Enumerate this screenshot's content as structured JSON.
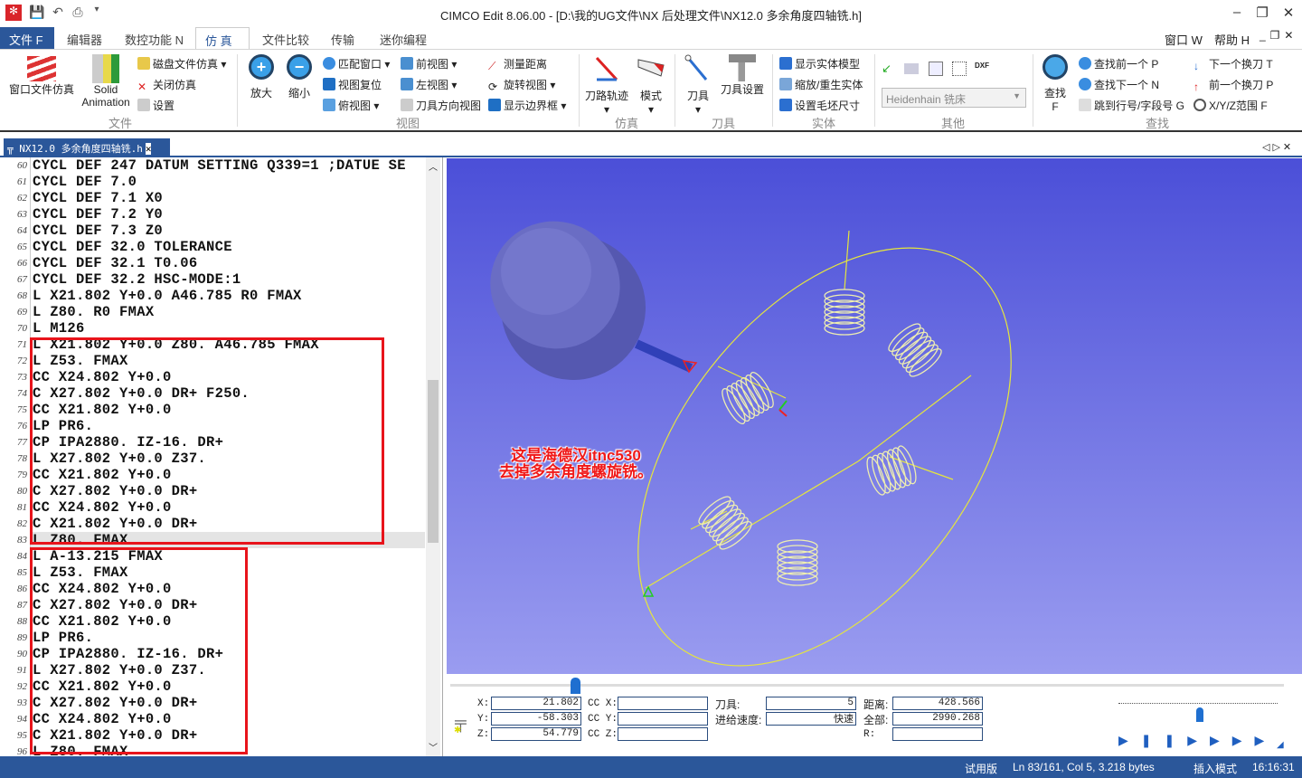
{
  "title": "CIMCO Edit 8.06.00 - [D:\\我的UG文件\\NX 后处理文件\\NX12.0 多余角度四轴铣.h]",
  "menu": {
    "tabs": [
      "文件 F",
      "编辑器",
      "数控功能 N",
      "仿 真",
      "文件比较",
      "传输",
      "迷你编程"
    ],
    "active": "仿 真",
    "right": [
      "窗口 W",
      "帮助 H"
    ]
  },
  "ribbon": {
    "file": {
      "group": "文件",
      "window_sim": "窗口文件仿真",
      "solid": "Solid",
      "animation": "Animation",
      "disk_sim": "磁盘文件仿真",
      "close_sim": "关闭仿真",
      "settings": "设置"
    },
    "view": {
      "group": "视图",
      "zoom_in": "放大",
      "zoom_out": "缩小",
      "fit": "匹配窗口",
      "reset": "视图复位",
      "top": "俯视图",
      "front": "前视图",
      "left": "左视图",
      "tool_dir": "刀具方向视图",
      "measure": "测量距离",
      "rotate": "旋转视图",
      "bbox": "显示边界框"
    },
    "sim": {
      "group": "仿真",
      "toolpath": "刀路轨迹",
      "mode": "模式"
    },
    "tool": {
      "group": "刀具",
      "tool": "刀具",
      "tool_settings": "刀具设置"
    },
    "solid": {
      "group": "实体",
      "show_solid": "显示实体模型",
      "zoom_regen": "缩放/重生实体",
      "stock": "设置毛坯尺寸"
    },
    "other": {
      "group": "其他",
      "machine": "Heidenhain 铣床",
      "dxf": "DXF"
    },
    "find": {
      "group": "查找",
      "find": "查找",
      "find_key": "F",
      "prev": "查找前一个 P",
      "next": "查找下一个 N",
      "goto": "跳到行号/字段号 G",
      "next_tool": "下一个换刀 T",
      "prev_tool": "前一个换刀 P",
      "range": "X/Y/Z范围 F"
    }
  },
  "doc_tab": "NX12.0 多余角度四轴铣.h",
  "editor": {
    "lines": [
      {
        "n": "60",
        "t": "CYCL DEF 247 DATUM SETTING Q339=1 ;DATUE SE"
      },
      {
        "n": "61",
        "t": "CYCL DEF 7.0"
      },
      {
        "n": "62",
        "t": "CYCL DEF 7.1 X0"
      },
      {
        "n": "63",
        "t": "CYCL DEF 7.2 Y0"
      },
      {
        "n": "64",
        "t": "CYCL DEF 7.3 Z0"
      },
      {
        "n": "65",
        "t": "CYCL DEF 32.0 TOLERANCE"
      },
      {
        "n": "66",
        "t": "CYCL DEF 32.1 T0.06"
      },
      {
        "n": "67",
        "t": "CYCL DEF 32.2 HSC-MODE:1"
      },
      {
        "n": "68",
        "t": "L X21.802 Y+0.0 A46.785 R0 FMAX"
      },
      {
        "n": "69",
        "t": "L Z80. R0 FMAX"
      },
      {
        "n": "70",
        "t": "L M126"
      },
      {
        "n": "71",
        "t": "L X21.802 Y+0.0 Z80. A46.785 FMAX"
      },
      {
        "n": "72",
        "t": "L Z53. FMAX"
      },
      {
        "n": "73",
        "t": "CC X24.802 Y+0.0"
      },
      {
        "n": "74",
        "t": "C X27.802 Y+0.0 DR+ F250."
      },
      {
        "n": "75",
        "t": "CC X21.802 Y+0.0"
      },
      {
        "n": "76",
        "t": "LP PR6."
      },
      {
        "n": "77",
        "t": "CP IPA2880. IZ-16. DR+"
      },
      {
        "n": "78",
        "t": "L X27.802 Y+0.0 Z37."
      },
      {
        "n": "79",
        "t": "CC X21.802 Y+0.0"
      },
      {
        "n": "80",
        "t": "C X27.802 Y+0.0 DR+"
      },
      {
        "n": "81",
        "t": "CC X24.802 Y+0.0"
      },
      {
        "n": "82",
        "t": "C X21.802 Y+0.0 DR+"
      },
      {
        "n": "83",
        "t": "L Z80. FMAX"
      },
      {
        "n": "84",
        "t": "L A-13.215 FMAX"
      },
      {
        "n": "85",
        "t": "L Z53. FMAX"
      },
      {
        "n": "86",
        "t": "CC X24.802 Y+0.0"
      },
      {
        "n": "87",
        "t": "C X27.802 Y+0.0 DR+"
      },
      {
        "n": "88",
        "t": "CC X21.802 Y+0.0"
      },
      {
        "n": "89",
        "t": "LP PR6."
      },
      {
        "n": "90",
        "t": "CP IPA2880. IZ-16. DR+"
      },
      {
        "n": "91",
        "t": "L X27.802 Y+0.0 Z37."
      },
      {
        "n": "92",
        "t": "CC X21.802 Y+0.0"
      },
      {
        "n": "93",
        "t": "C X27.802 Y+0.0 DR+"
      },
      {
        "n": "94",
        "t": "CC X24.802 Y+0.0"
      },
      {
        "n": "95",
        "t": "C X21.802 Y+0.0 DR+"
      },
      {
        "n": "96",
        "t": "L Z80. FMAX"
      }
    ],
    "current_line": "83"
  },
  "annotation": [
    "这是海德汉itnc530",
    "去掉多余角度螺旋铣。"
  ],
  "sim_panel": {
    "x_label": "X:",
    "x": "21.802",
    "y_label": "Y:",
    "y": "-58.303",
    "z_label": "Z:",
    "z": "54.779",
    "ccx_label": "CC X:",
    "ccy_label": "CC Y:",
    "ccz_label": "CC Z:",
    "tool_label": "刀具:",
    "tool": "5",
    "feed_label": "进给速度:",
    "feed": "快速",
    "dist_label": "距离:",
    "dist": "428.566",
    "total_label": "全部:",
    "total": "2990.268",
    "r_label": "R:",
    "progress": 0.15
  },
  "status": {
    "trial": "试用版",
    "position": "Ln 83/161, Col 5, 3.218 bytes",
    "mode": "插入模式",
    "time": "16:16:31"
  },
  "colors": {
    "accent": "#2b579a",
    "highlight_box": "#e8141b",
    "view_bg_top": "#4b4fd8",
    "view_bg_bottom": "#9a9cf0",
    "path": "#e6e63c"
  }
}
